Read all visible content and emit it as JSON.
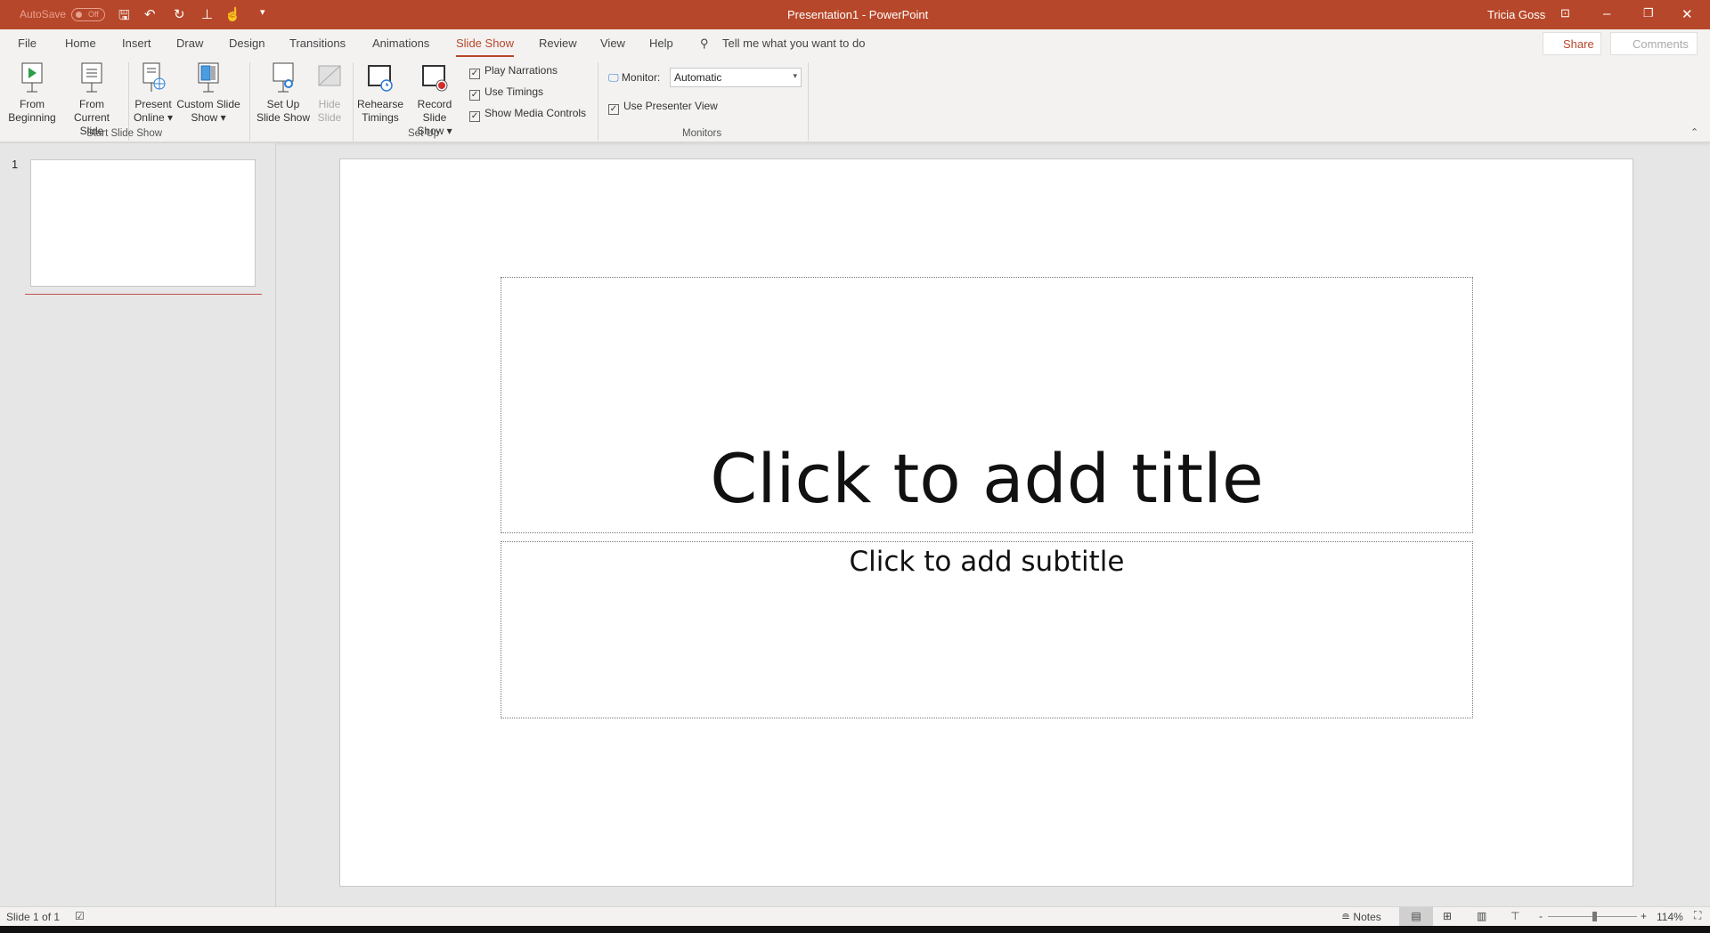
{
  "titlebar": {
    "autosave": "AutoSave",
    "autosave_state": "Off",
    "title": "Presentation1  -  PowerPoint",
    "user": "Tricia Goss",
    "accent": "#b7472a"
  },
  "tabs": [
    {
      "label": "File"
    },
    {
      "label": "Home"
    },
    {
      "label": "Insert"
    },
    {
      "label": "Draw"
    },
    {
      "label": "Design"
    },
    {
      "label": "Transitions"
    },
    {
      "label": "Animations"
    },
    {
      "label": "Slide Show",
      "active": true
    },
    {
      "label": "Review"
    },
    {
      "label": "View"
    },
    {
      "label": "Help"
    }
  ],
  "search": {
    "placeholder": "Tell me what you want to do"
  },
  "share": "Share",
  "comments": "Comments",
  "ribbon": {
    "start_group": "Start Slide Show",
    "setup_group": "Set Up",
    "monitors_group": "Monitors",
    "from_beginning": [
      "From",
      "Beginning"
    ],
    "from_current": [
      "From",
      "Current Slide"
    ],
    "present_online": [
      "Present",
      "Online ▾"
    ],
    "custom_show": [
      "Custom Slide",
      "Show ▾"
    ],
    "setup_show": [
      "Set Up",
      "Slide Show"
    ],
    "hide_slide": [
      "Hide",
      "Slide"
    ],
    "rehearse": [
      "Rehearse",
      "Timings"
    ],
    "record": [
      "Record Slide",
      "Show ▾"
    ],
    "play_narrations": "Play Narrations",
    "use_timings": "Use Timings",
    "show_media": "Show Media Controls",
    "monitor_label": "Monitor:",
    "monitor_value": "Automatic",
    "presenter_view": "Use Presenter View"
  },
  "thumbnails": [
    {
      "number": "1"
    }
  ],
  "slide": {
    "title": "Click to add title",
    "subtitle": "Click to add subtitle"
  },
  "status": {
    "slide": "Slide 1 of 1",
    "notes": "Notes",
    "zoom": "114%",
    "minus": "-",
    "plus": "+"
  }
}
